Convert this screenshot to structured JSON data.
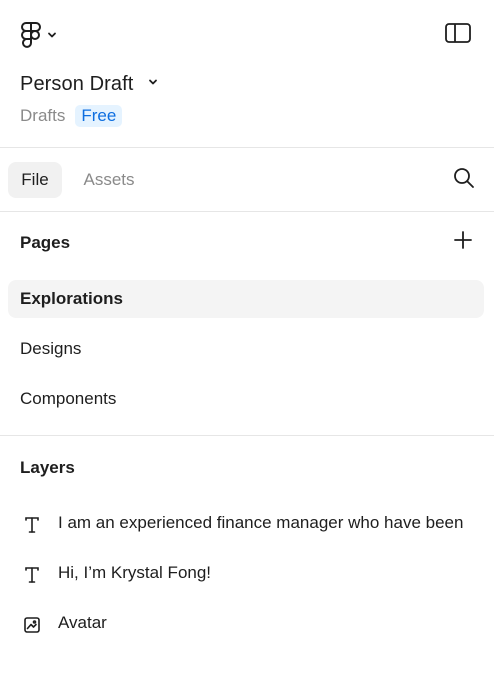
{
  "header": {
    "file_name": "Person Draft",
    "location": "Drafts",
    "plan_badge": "Free"
  },
  "tabs": [
    {
      "label": "File",
      "active": true
    },
    {
      "label": "Assets",
      "active": false
    }
  ],
  "pages": {
    "title": "Pages",
    "items": [
      {
        "label": "Explorations",
        "active": true
      },
      {
        "label": "Designs",
        "active": false
      },
      {
        "label": "Components",
        "active": false
      }
    ]
  },
  "layers": {
    "title": "Layers",
    "items": [
      {
        "label": "I am an experienced finance manager who have been",
        "icon": "text-icon"
      },
      {
        "label": "Hi, I’m Krystal Fong!",
        "icon": "text-icon"
      },
      {
        "label": "Avatar",
        "icon": "image-icon"
      }
    ]
  },
  "colors": {
    "accent": "#0d6ee0",
    "badge_bg": "#e5f3ff",
    "active_bg": "#f4f4f4",
    "muted_text": "#8a8a8a"
  }
}
